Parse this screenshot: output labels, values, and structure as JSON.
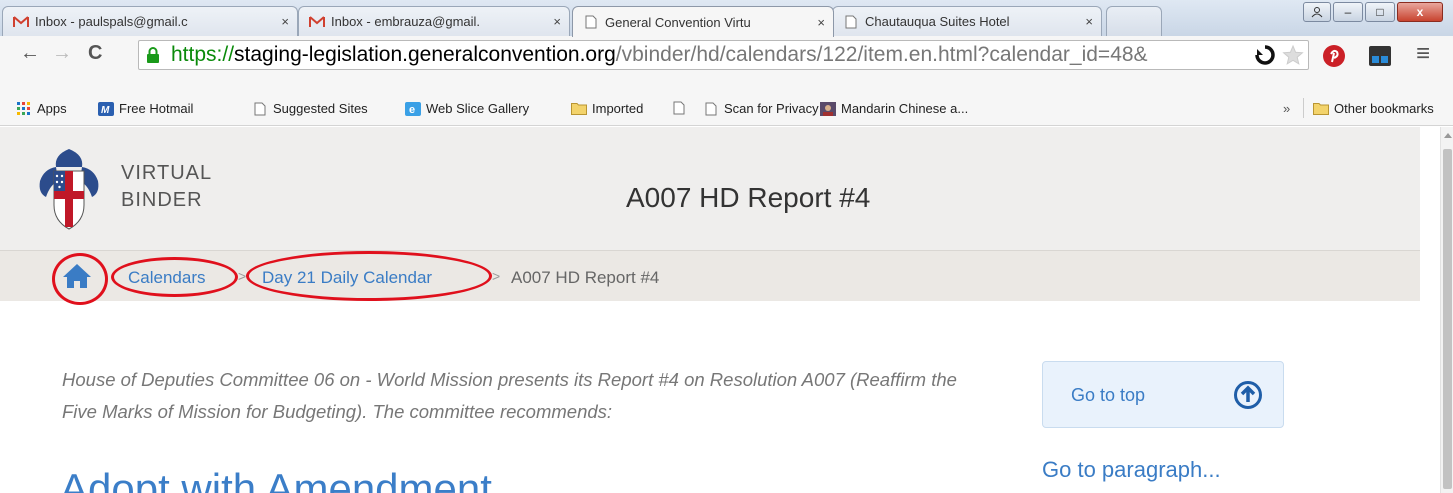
{
  "browser": {
    "tabs": [
      {
        "title": "Inbox - paulspals@gmail.c",
        "icon": "gmail-icon",
        "active": false
      },
      {
        "title": "Inbox - embrauza@gmail.",
        "icon": "gmail-icon",
        "active": false
      },
      {
        "title": "General Convention Virtu",
        "icon": "page-icon",
        "active": true
      },
      {
        "title": "Chautauqua Suites Hotel",
        "icon": "page-icon",
        "active": false
      }
    ],
    "tab_close": "×",
    "url": {
      "scheme": "https://",
      "host": "staging-legislation.generalconvention.org",
      "path": "/vbinder/hd/calendars/122/item.en.html?calendar_id=48&"
    },
    "nav": {
      "back": "←",
      "forward": "→",
      "reload": "C"
    },
    "menu": "≡",
    "bookmarks": [
      {
        "label": "Apps",
        "icon": "apps-grid-icon"
      },
      {
        "label": "Free Hotmail",
        "icon": "msn-icon"
      },
      {
        "label": "Suggested Sites",
        "icon": "page-icon"
      },
      {
        "label": "Web Slice Gallery",
        "icon": "ie-icon"
      },
      {
        "label": "Imported",
        "icon": "folder-icon"
      },
      {
        "label": "",
        "icon": "page-icon"
      },
      {
        "label": "Scan for Privacy",
        "icon": "page-icon"
      },
      {
        "label": "Mandarin Chinese a...",
        "icon": "thumbnail-icon"
      }
    ],
    "bookmarks_overflow": "»",
    "other_bookmarks": "Other bookmarks",
    "window_controls": {
      "minimize": "–",
      "maximize": "□",
      "close": "x"
    }
  },
  "site": {
    "name_line1": "VIRTUAL",
    "name_line2": "BINDER",
    "title": "A007 HD Report #4"
  },
  "breadcrumb": {
    "items": [
      "Calendars",
      "Day 21 Daily Calendar"
    ],
    "current": "A007 HD Report #4",
    "separator": ">"
  },
  "content": {
    "summary": "House of Deputies Committee 06 on - World Mission presents its Report #4 on Resolution A007 (Reaffirm the Five Marks of Mission for Budgeting). The committee recommends:",
    "recommendation": "Adopt with Amendment"
  },
  "sidebar": {
    "go_to_top": "Go to top",
    "go_to_paragraph": "Go to paragraph..."
  },
  "colors": {
    "link": "#3a7cc5",
    "annotation": "#e0101c",
    "header_bg": "#efeeed"
  }
}
